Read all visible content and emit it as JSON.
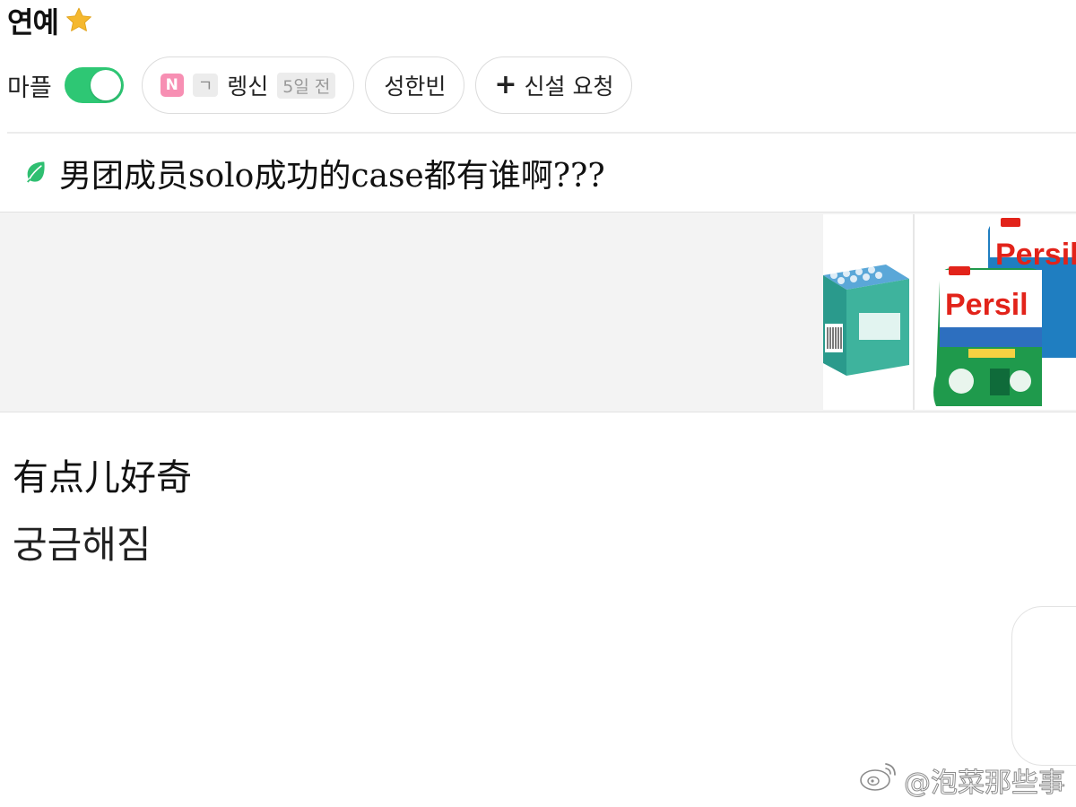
{
  "header": {
    "category_title": "연예",
    "star_icon": "star-icon"
  },
  "filters": {
    "mapl_label": "마플",
    "mapl_toggle_on": true,
    "chips": [
      {
        "badge_n": "N",
        "badge_letter": "ㄱ",
        "label": "렝신",
        "time": "5일 전"
      },
      {
        "label": "성한빈"
      },
      {
        "label": "신설 요청",
        "icon": "plus-icon"
      }
    ]
  },
  "post": {
    "title_icon": "leaf-icon",
    "title": "男团成员solo成功的case都有谁啊???",
    "body_zh": "有点儿好奇",
    "body_ko": "궁금해짐"
  },
  "ad": {
    "product_brand": "Persil"
  },
  "watermark": {
    "text": "@泡菜那些事",
    "icon": "weibo-icon"
  },
  "colors": {
    "toggle_on": "#2ec774",
    "star": "#f5b82e",
    "leaf": "#2fbf71",
    "persil_red": "#e2231a",
    "badge_pink": "#f78fb3"
  }
}
